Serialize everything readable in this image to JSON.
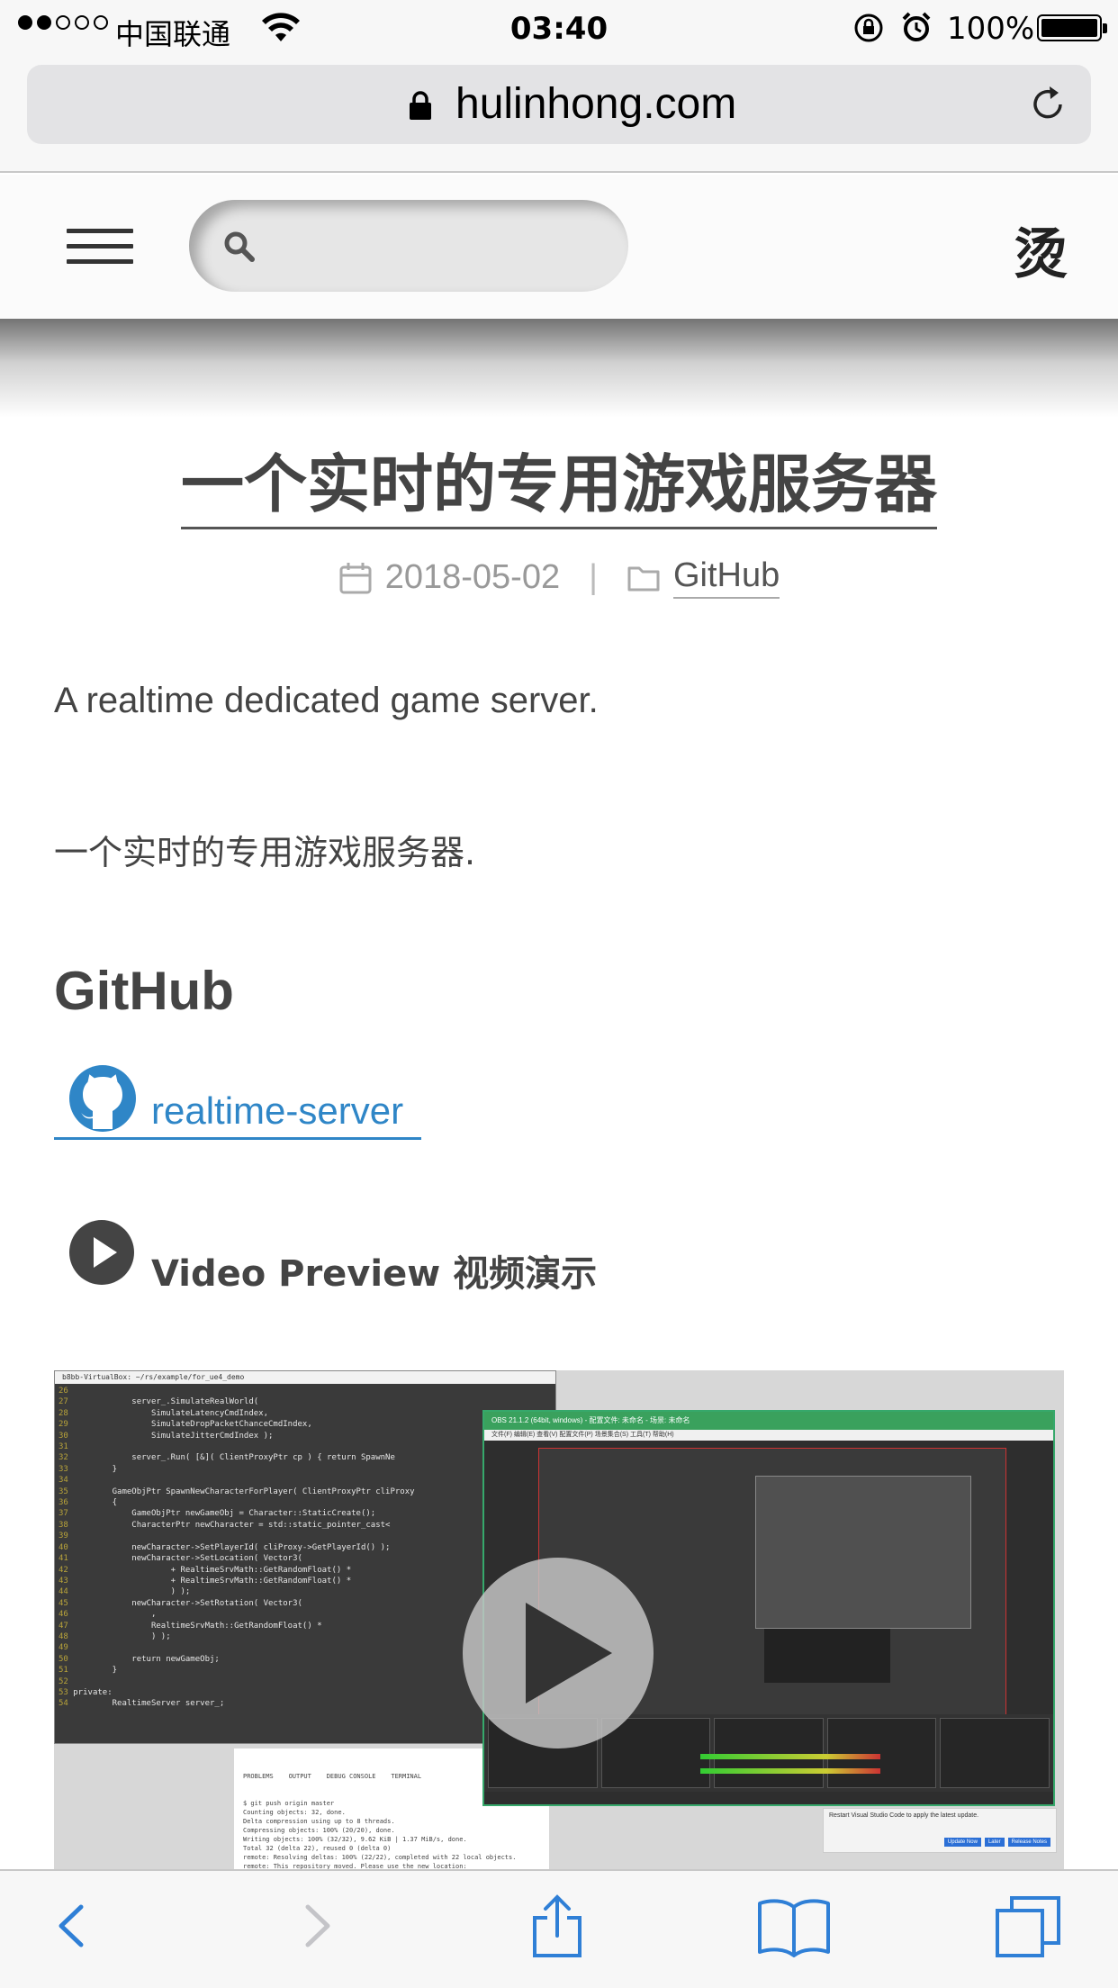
{
  "status_bar": {
    "carrier": "中国联通",
    "time": "03:40",
    "battery": "100%",
    "signal_bars_filled": 2,
    "signal_bars_total": 5
  },
  "browser": {
    "url": "hulinhong.com"
  },
  "site_header": {
    "logo_text": "烫",
    "search_placeholder": ""
  },
  "post": {
    "title": "一个实时的专用游戏服务器",
    "date": "2018-05-02",
    "category": "GitHub",
    "paragraph_en": "A realtime dedicated game server.",
    "paragraph_zh": "一个实时的专用游戏服务器.",
    "section_heading": "GitHub",
    "repo_link": "realtime-server",
    "video_label": "Video Preview 视频演示"
  },
  "video_thumbnail": {
    "terminal_title": "b8bb-VirtualBox: ~/rs/example/for_ue4_demo",
    "code_lines": [
      {
        "n": "26",
        "t": ""
      },
      {
        "n": "27",
        "t": "            server_.SimulateRealWorld("
      },
      {
        "n": "28",
        "t": "                SimulateLatencyCmdIndex,"
      },
      {
        "n": "29",
        "t": "                SimulateDropPacketChanceCmdIndex,"
      },
      {
        "n": "30",
        "t": "                SimulateJitterCmdIndex );"
      },
      {
        "n": "31",
        "t": ""
      },
      {
        "n": "32",
        "t": "            server_.Run( [&]( ClientProxyPtr cp ) { return SpawnNe"
      },
      {
        "n": "33",
        "t": "        }"
      },
      {
        "n": "34",
        "t": ""
      },
      {
        "n": "35",
        "t": "        GameObjPtr SpawnNewCharacterForPlayer( ClientProxyPtr cliProxy"
      },
      {
        "n": "36",
        "t": "        {"
      },
      {
        "n": "37",
        "t": "            GameObjPtr newGameObj = Character::StaticCreate();"
      },
      {
        "n": "38",
        "t": "            CharacterPtr newCharacter = std::static_pointer_cast<"
      },
      {
        "n": "39",
        "t": ""
      },
      {
        "n": "40",
        "t": "            newCharacter->SetPlayerId( cliProxy->GetPlayerId() );"
      },
      {
        "n": "41",
        "t": "            newCharacter->SetLocation( Vector3("
      },
      {
        "n": "42",
        "t": "                    + RealtimeSrvMath::GetRandomFloat() *"
      },
      {
        "n": "43",
        "t": "                    + RealtimeSrvMath::GetRandomFloat() *"
      },
      {
        "n": "44",
        "t": "                    ) );"
      },
      {
        "n": "45",
        "t": "            newCharacter->SetRotation( Vector3("
      },
      {
        "n": "46",
        "t": "                ,"
      },
      {
        "n": "47",
        "t": "                RealtimeSrvMath::GetRandomFloat() *"
      },
      {
        "n": "48",
        "t": "                ) );"
      },
      {
        "n": "49",
        "t": ""
      },
      {
        "n": "50",
        "t": "            return newGameObj;"
      },
      {
        "n": "51",
        "t": "        }"
      },
      {
        "n": "52",
        "t": ""
      },
      {
        "n": "53",
        "t": "private:"
      },
      {
        "n": "54",
        "t": "        RealtimeServer server_;"
      }
    ],
    "vscode_tabs": "PROBLEMS    OUTPUT    DEBUG CONSOLE    TERMINAL",
    "vscode_lines": [
      "$ git push origin master",
      "Counting objects: 32, done.",
      "Delta compression using up to 8 threads.",
      "Compressing objects: 100% (20/20), done.",
      "Writing objects: 100% (32/32), 9.62 KiB | 1.37 MiB/s, done.",
      "Total 32 (delta 22), reused 0 (delta 0)",
      "remote: Resolving deltas: 100% (22/22), completed with 22 local objects.",
      "remote: This repository moved. Please use the new location:"
    ],
    "obs_title": "OBS 21.1.2 (64bit, windows) - 配置文件: 未命名 - 场景: 未命名",
    "obs_menu": "文件(F)   编辑(E)   查看(V)   配置文件(P)   场景集合(S)   工具(T)   帮助(H)",
    "toast_text": "Restart Visual Studio Code to apply the latest update.",
    "toast_buttons": [
      "Update Now",
      "Later",
      "Release Notes"
    ]
  },
  "icons": {
    "menu": "hamburger-icon",
    "search": "search-icon",
    "calendar": "calendar-icon",
    "folder": "folder-icon",
    "github": "github-icon",
    "play": "play-icon",
    "lock": "lock-icon",
    "reload": "reload-icon",
    "back": "back-icon",
    "forward": "forward-icon",
    "share": "share-icon",
    "bookmarks": "book-icon",
    "tabs": "tabs-icon"
  },
  "colors": {
    "link": "#2f86c7",
    "text": "#444444",
    "meta": "#999999"
  }
}
